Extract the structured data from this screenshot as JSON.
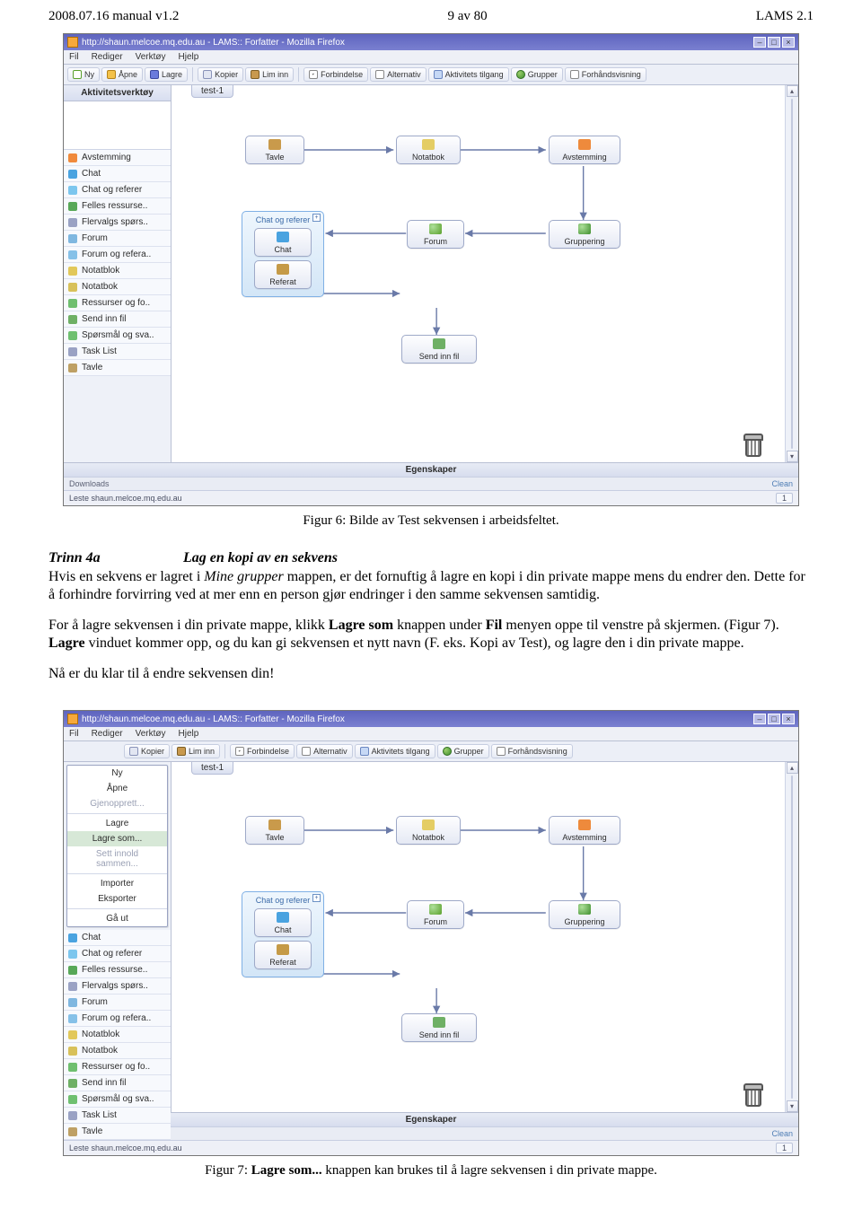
{
  "page_header": {
    "left": "2008.07.16 manual v1.2",
    "center": "9  av 80",
    "right": "LAMS 2.1"
  },
  "caption6_prefix": "Figur 6: ",
  "caption6_rest": "Bilde av Test sekvensen i arbeidsfeltet.",
  "trinn": {
    "label": "Trinn 4a",
    "title": "Lag en kopi av en sekvens"
  },
  "para1_a": "Hvis en sekvens er lagret i ",
  "para1_b": "Mine grupper",
  "para1_c": " mappen, er det fornuftig å lagre en kopi i din private mappe mens du endrer den. Dette for å forhindre forvirring ved at mer enn en person gjør endringer i den samme sekvensen samtidig.",
  "para2_a": "For å lagre sekvensen i din private mappe, klikk ",
  "para2_b": "Lagre som",
  "para2_c": "  knappen under ",
  "para2_d": "Fil",
  "para2_e": " menyen oppe til venstre på skjermen. (Figur 7). ",
  "para2_f": "Lagre",
  "para2_g": " vinduet kommer opp, og du kan gi sekvensen et nytt navn (F. eks. Kopi av Test), og lagre den i din private mappe.",
  "para3": "Nå er du klar til å endre sekvensen din!",
  "caption7_prefix": "Figur 7: ",
  "caption7_bold": "Lagre  som...",
  "caption7_rest": " knappen kan brukes til å lagre sekvensen i din private mappe.",
  "shot": {
    "title_url": "http://shaun.melcoe.mq.edu.au - LAMS:: Forfatter - Mozilla Firefox",
    "menubar": {
      "fil": "Fil",
      "rediger": "Rediger",
      "verktoy": "Verktøy",
      "hjelp": "Hjelp"
    },
    "toolbar": {
      "ny": "Ny",
      "apne": "Åpne",
      "lagre": "Lagre",
      "kopier": "Kopier",
      "lim": "Lim inn",
      "forbindelse": "Forbindelse",
      "alternativ": "Alternativ",
      "tilgang": "Aktivitets tilgang",
      "grupper": "Grupper",
      "forhand": "Forhåndsvisning"
    },
    "side_title": "Aktivitetsverktøy",
    "side_items": {
      "avstemming": "Avstemming",
      "chat": "Chat",
      "chatref": "Chat og referer",
      "felles": "Felles ressurse..",
      "flervalg": "Flervalgs spørs..",
      "forum": "Forum",
      "forumref": "Forum og refera..",
      "notatblok": "Notatblok",
      "notatbok": "Notatbok",
      "ressurser": "Ressurser og fo..",
      "sendfil": "Send inn fil",
      "sporsmal": "Spørsmål og sva..",
      "tasklist": "Task List",
      "tavle": "Tavle"
    },
    "tab": "test-1",
    "nodes": {
      "tavle": "Tavle",
      "notatbok": "Notatbok",
      "avstemming": "Avstemming",
      "chatref": "Chat og referer",
      "chat": "Chat",
      "referat": "Referat",
      "forum": "Forum",
      "gruppering": "Gruppering",
      "sendfil": "Send inn fil"
    },
    "eg": "Egenskaper",
    "downloads": "Downloads",
    "clean": "Clean",
    "status": "Leste shaun.melcoe.mq.edu.au",
    "one": "1",
    "filemenu": {
      "ny": "Ny",
      "apne": "Åpne",
      "gjen": "Gjenopprett...",
      "lagre": "Lagre",
      "lagresom": "Lagre som...",
      "sett": "Sett innold sammen...",
      "importer": "Importer",
      "eksporter": "Eksporter",
      "gaut": "Gå ut"
    }
  }
}
